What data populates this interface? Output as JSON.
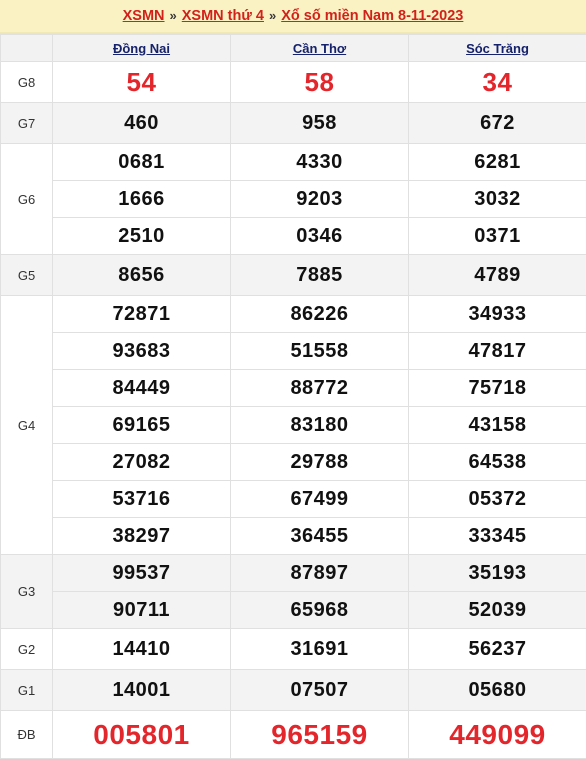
{
  "banner": {
    "crumb1": "XSMN",
    "sep1": "»",
    "crumb2": "XSMN thứ 4",
    "sep2": "»",
    "crumb3": "Xổ số miền Nam 8-11-2023"
  },
  "colors": {
    "banner_bg": "#fbf2c4",
    "crumb_link": "#d1211b",
    "province_link": "#16226b",
    "highlight_red": "#e3262b",
    "row_gray": "#f3f3f3",
    "row_white": "#ffffff"
  },
  "table": {
    "corner_label": "",
    "provinces": [
      "Đồng Nai",
      "Cần Thơ",
      "Sóc Trăng"
    ],
    "prizes": [
      {
        "label": "G8",
        "style": "red-large",
        "band": "white",
        "rows": [
          [
            "54",
            "58",
            "34"
          ]
        ]
      },
      {
        "label": "G7",
        "style": "normal",
        "band": "gray",
        "rows": [
          [
            "460",
            "958",
            "672"
          ]
        ]
      },
      {
        "label": "G6",
        "style": "normal",
        "band": "white",
        "rows": [
          [
            "0681",
            "4330",
            "6281"
          ],
          [
            "1666",
            "9203",
            "3032"
          ],
          [
            "2510",
            "0346",
            "0371"
          ]
        ]
      },
      {
        "label": "G5",
        "style": "normal",
        "band": "gray",
        "rows": [
          [
            "8656",
            "7885",
            "4789"
          ]
        ]
      },
      {
        "label": "G4",
        "style": "normal",
        "band": "white",
        "rows": [
          [
            "72871",
            "86226",
            "34933"
          ],
          [
            "93683",
            "51558",
            "47817"
          ],
          [
            "84449",
            "88772",
            "75718"
          ],
          [
            "69165",
            "83180",
            "43158"
          ],
          [
            "27082",
            "29788",
            "64538"
          ],
          [
            "53716",
            "67499",
            "05372"
          ],
          [
            "38297",
            "36455",
            "33345"
          ]
        ]
      },
      {
        "label": "G3",
        "style": "normal",
        "band": "gray",
        "rows": [
          [
            "99537",
            "87897",
            "35193"
          ],
          [
            "90711",
            "65968",
            "52039"
          ]
        ]
      },
      {
        "label": "G2",
        "style": "normal",
        "band": "white",
        "rows": [
          [
            "14410",
            "31691",
            "56237"
          ]
        ]
      },
      {
        "label": "G1",
        "style": "normal",
        "band": "gray",
        "rows": [
          [
            "14001",
            "07507",
            "05680"
          ]
        ]
      },
      {
        "label": "ĐB",
        "style": "red-xlarge",
        "band": "white",
        "rows": [
          [
            "005801",
            "965159",
            "449099"
          ]
        ]
      }
    ]
  }
}
